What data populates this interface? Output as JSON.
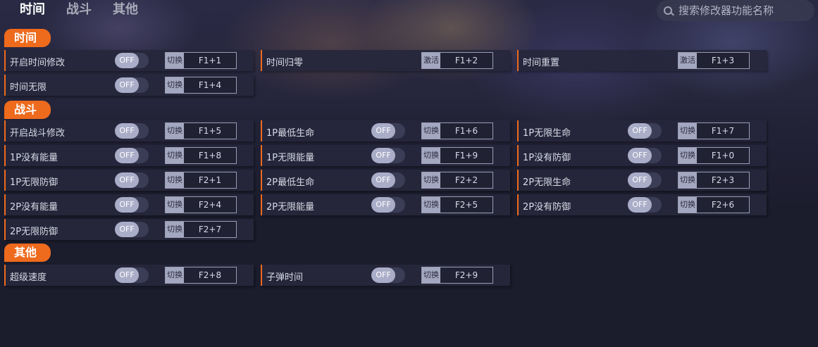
{
  "tabs": [
    "时间",
    "战斗",
    "其他"
  ],
  "search": {
    "placeholder": "搜索修改器功能名称"
  },
  "colors": {
    "accent": "#ee6a1d",
    "panel": "#26273c",
    "background": "#1b1c2c"
  },
  "sections": [
    {
      "title": "时间",
      "rows": [
        {
          "label": "开启时间修改",
          "toggle": "OFF",
          "action": "切换",
          "key": "F1+1"
        },
        {
          "label": "时间归零",
          "action": "激活",
          "key": "F1+2"
        },
        {
          "label": "时间重置",
          "action": "激活",
          "key": "F1+3"
        },
        {
          "label": "时间无限",
          "toggle": "OFF",
          "action": "切换",
          "key": "F1+4"
        }
      ]
    },
    {
      "title": "战斗",
      "rows": [
        {
          "label": "开启战斗修改",
          "toggle": "OFF",
          "action": "切换",
          "key": "F1+5"
        },
        {
          "label": "1P最低生命",
          "toggle": "OFF",
          "action": "切换",
          "key": "F1+6"
        },
        {
          "label": "1P无限生命",
          "toggle": "OFF",
          "action": "切换",
          "key": "F1+7"
        },
        {
          "label": "1P没有能量",
          "toggle": "OFF",
          "action": "切换",
          "key": "F1+8"
        },
        {
          "label": "1P无限能量",
          "toggle": "OFF",
          "action": "切换",
          "key": "F1+9"
        },
        {
          "label": "1P没有防御",
          "toggle": "OFF",
          "action": "切换",
          "key": "F1+0"
        },
        {
          "label": "1P无限防御",
          "toggle": "OFF",
          "action": "切换",
          "key": "F2+1"
        },
        {
          "label": "2P最低生命",
          "toggle": "OFF",
          "action": "切换",
          "key": "F2+2"
        },
        {
          "label": "2P无限生命",
          "toggle": "OFF",
          "action": "切换",
          "key": "F2+3"
        },
        {
          "label": "2P没有能量",
          "toggle": "OFF",
          "action": "切换",
          "key": "F2+4"
        },
        {
          "label": "2P无限能量",
          "toggle": "OFF",
          "action": "切换",
          "key": "F2+5"
        },
        {
          "label": "2P没有防御",
          "toggle": "OFF",
          "action": "切换",
          "key": "F2+6"
        },
        {
          "label": "2P无限防御",
          "toggle": "OFF",
          "action": "切换",
          "key": "F2+7"
        }
      ]
    },
    {
      "title": "其他",
      "rows": [
        {
          "label": "超级速度",
          "toggle": "OFF",
          "action": "切换",
          "key": "F2+8"
        },
        {
          "label": "子弹时间",
          "toggle": "OFF",
          "action": "切换",
          "key": "F2+9"
        }
      ]
    }
  ]
}
